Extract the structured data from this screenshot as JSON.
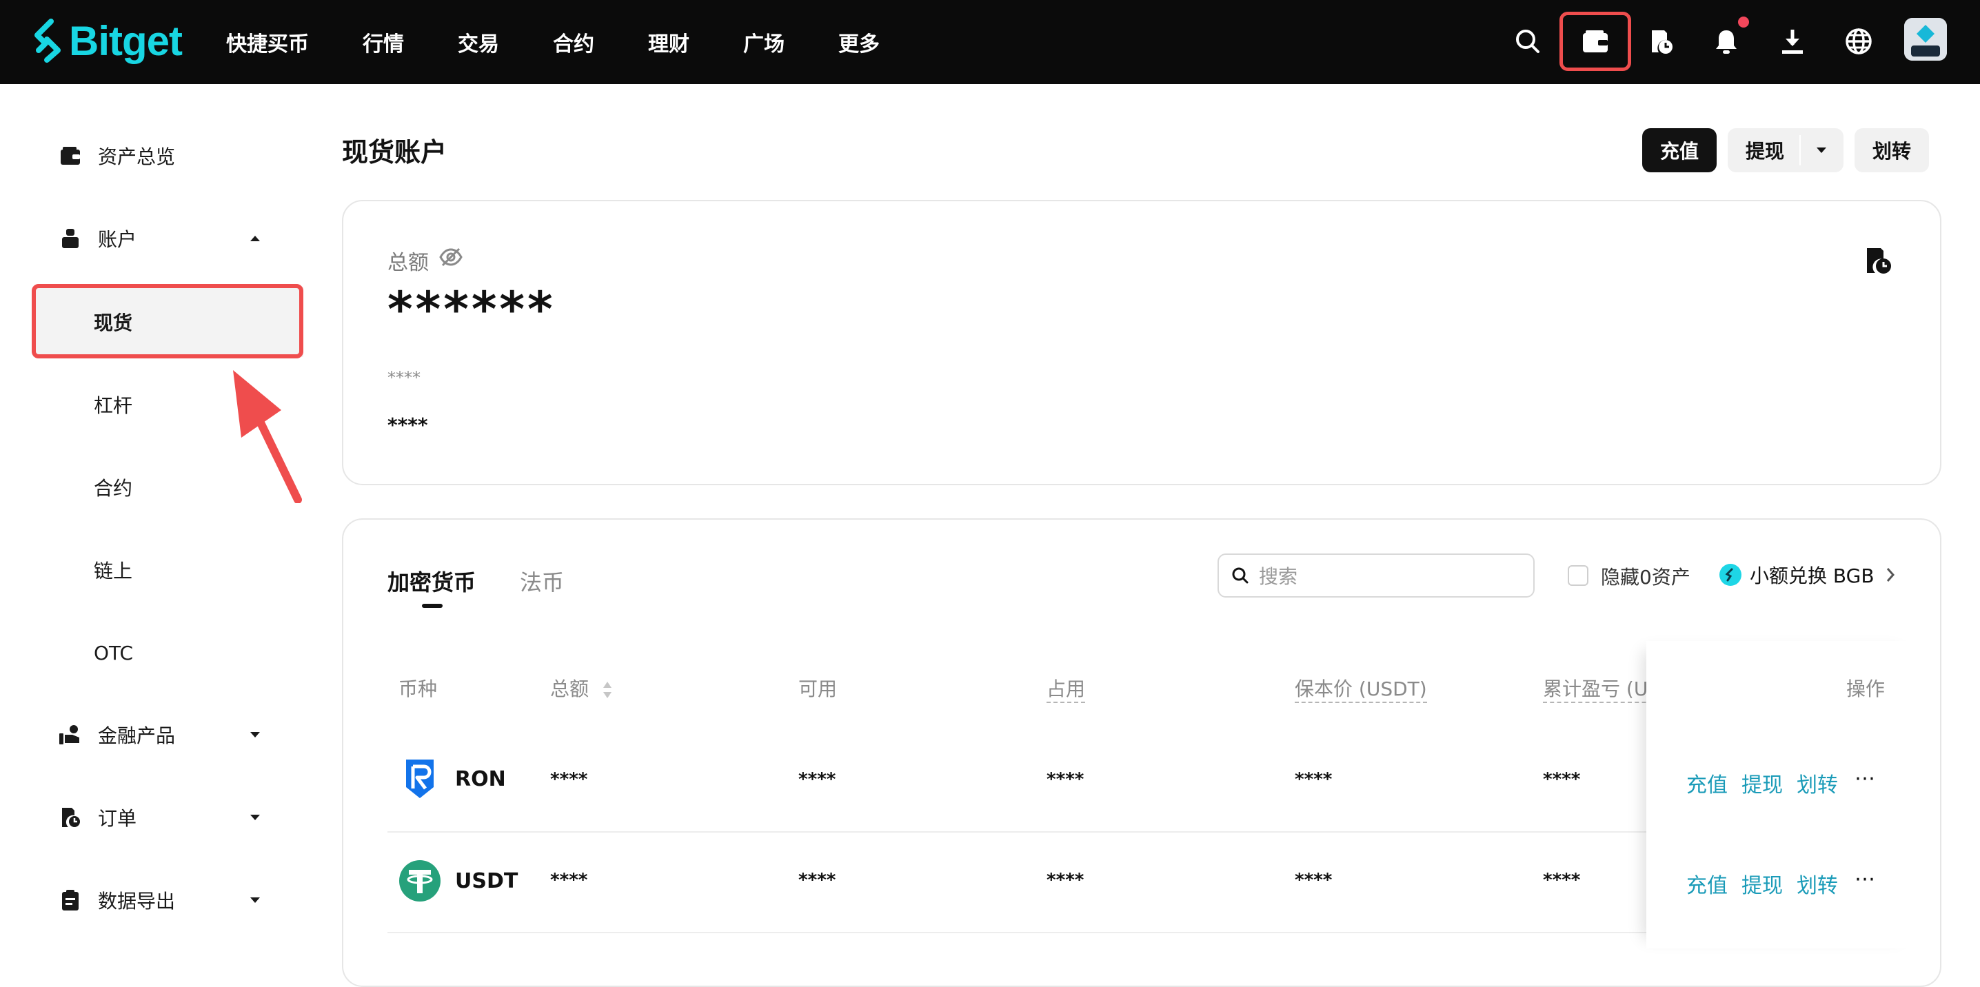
{
  "brand": {
    "name": "Bitget",
    "color": "#18d6e3"
  },
  "nav": {
    "items": [
      "快捷买币",
      "行情",
      "交易",
      "合约",
      "理财",
      "广场",
      "更多"
    ]
  },
  "header_icons": [
    "search-icon",
    "wallet-icon",
    "order-history-icon",
    "bell-icon",
    "download-icon",
    "globe-icon"
  ],
  "sidebar": {
    "overview": "资产总览",
    "account": "账户",
    "sub_items": [
      "现货",
      "杠杆",
      "合约",
      "链上",
      "OTC"
    ],
    "finance": "金融产品",
    "orders": "订单",
    "export": "数据导出"
  },
  "page": {
    "title": "现货账户",
    "deposit": "充值",
    "withdraw": "提现",
    "transfer": "划转"
  },
  "summary": {
    "total_label": "总额",
    "total_value": "******",
    "sub_value_1": "****",
    "sub_value_2": "****"
  },
  "assets": {
    "tabs": [
      "加密货币",
      "法币"
    ],
    "search_placeholder": "搜索",
    "hide_zero_label": "隐藏0资产",
    "convert_label": "小额兑换 BGB",
    "columns": {
      "coin": "币种",
      "total": "总额",
      "available": "可用",
      "frozen": "占用",
      "cost": "保本价 (USDT)",
      "pnl": "累计盈亏 (US",
      "action": "操作"
    },
    "rows": [
      {
        "coin": "RON",
        "total": "****",
        "available": "****",
        "frozen": "****",
        "cost": "****",
        "pnl": "****"
      },
      {
        "coin": "USDT",
        "total": "****",
        "available": "****",
        "frozen": "****",
        "cost": "****",
        "pnl": "****"
      }
    ],
    "row_actions": {
      "deposit": "充值",
      "withdraw": "提现",
      "transfer": "划转",
      "more": "⋯"
    }
  },
  "colors": {
    "accent_link": "#1a9bb8",
    "highlight": "#ef4d4d",
    "primary_button": "#121212"
  }
}
